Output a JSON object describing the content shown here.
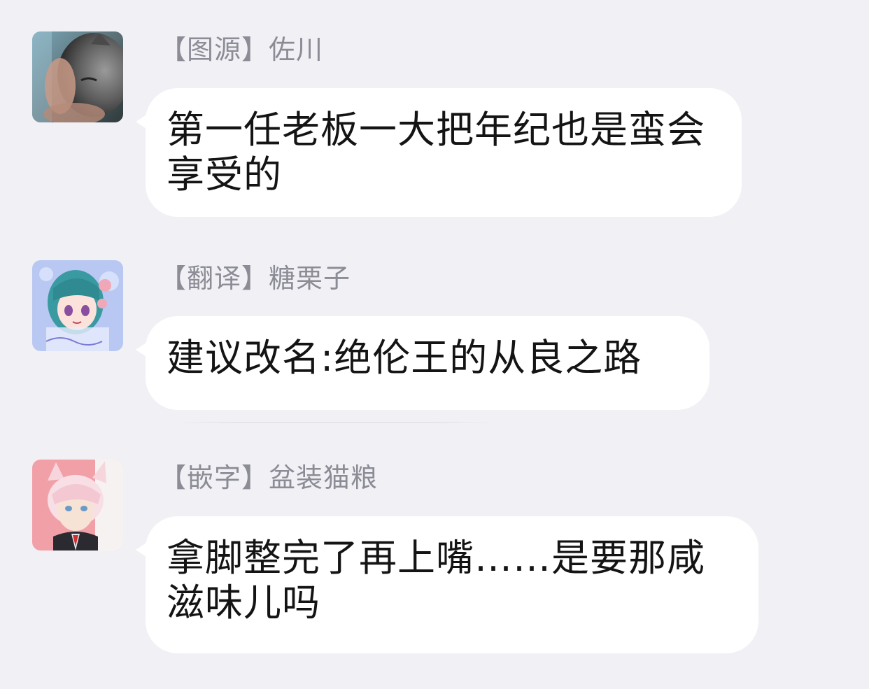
{
  "messages": [
    {
      "sender": "【图源】佐川",
      "avatar_icon": "cat-photo-avatar",
      "text": "第一任老板一大把年纪也是蛮会享受的"
    },
    {
      "sender": "【翻译】糖栗子",
      "avatar_icon": "anime-girl-teal-hair-avatar",
      "text": "建议改名:绝伦王的从良之路"
    },
    {
      "sender": "【嵌字】盆装猫粮",
      "avatar_icon": "anime-catboy-pink-hair-avatar",
      "text": "拿脚整完了再上嘴……是要那咸滋味儿吗"
    }
  ],
  "colors": {
    "background": "#f1f1f5",
    "bubble": "#ffffff",
    "sender_text": "#8c8c96",
    "message_text": "#141414"
  }
}
